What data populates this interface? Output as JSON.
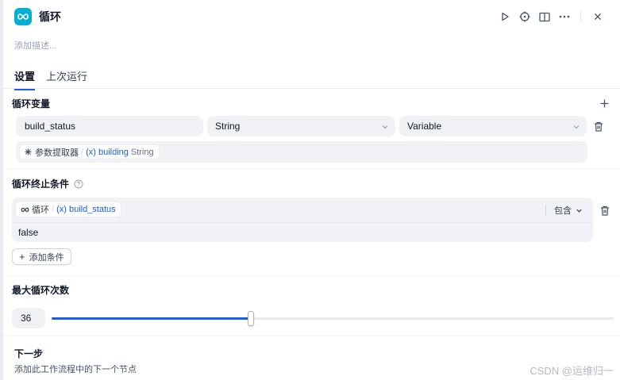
{
  "header": {
    "title": "循环",
    "icon": "loop-icon",
    "actions": [
      "play-icon",
      "crosshair-icon",
      "book-icon",
      "more-icon",
      "close-icon"
    ]
  },
  "description_placeholder": "添加描述...",
  "tabs": [
    {
      "label": "设置",
      "active": true
    },
    {
      "label": "上次运行",
      "active": false
    }
  ],
  "loop_variables": {
    "title": "循环变量",
    "add_icon": "plus-icon",
    "items": [
      {
        "name": "build_status",
        "type": "String",
        "value_mode": "Variable",
        "source_node": "参数提取器",
        "source_var": "building",
        "source_type": "String"
      }
    ]
  },
  "termination": {
    "title": "循环终止条件",
    "help_icon": "help-circle-icon",
    "condition": {
      "node": "循环",
      "variable": "build_status",
      "operator": "包含",
      "value": "false"
    },
    "add_condition_label": "添加条件"
  },
  "max_loops": {
    "title": "最大循环次数",
    "value": "36",
    "slider_fraction": 0.354
  },
  "next_step": {
    "title": "下一步",
    "description": "添加此工作流程中的下一个节点"
  },
  "watermark": "CSDN @运维归一",
  "colors": {
    "accent": "#155eef",
    "node_icon_bg": "#06aed4",
    "field_bg": "#f0f2f5"
  }
}
